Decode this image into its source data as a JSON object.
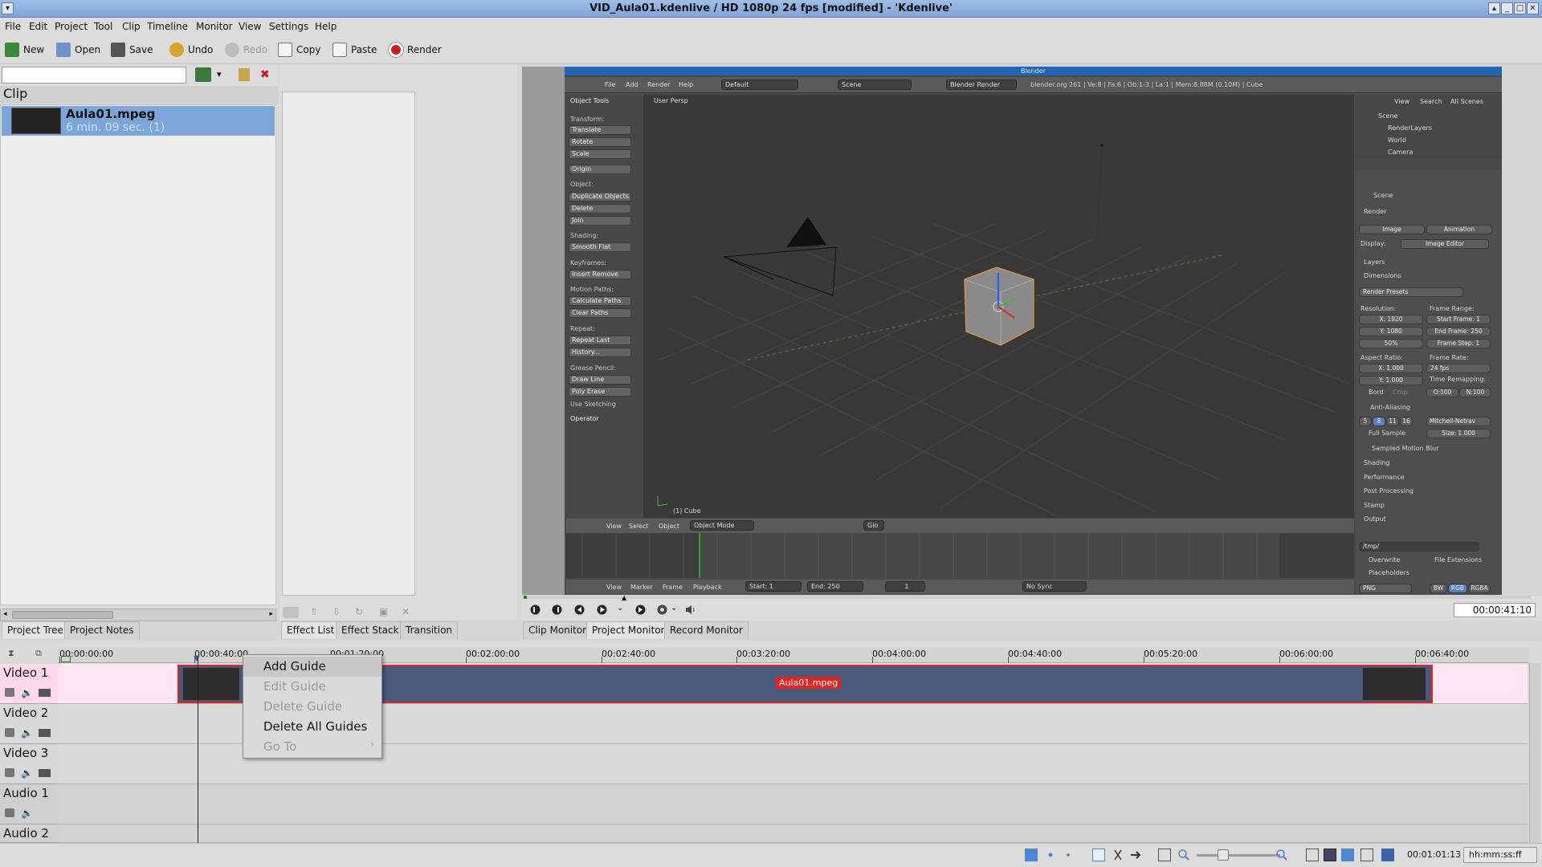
{
  "window": {
    "title": "VID_Aula01.kdenlive / HD 1080p 24 fps [modified] - 'Kdenlive'",
    "buttons": [
      "▴",
      "_",
      "□",
      "✕"
    ]
  },
  "menu": [
    "File",
    "Edit",
    "Project",
    "Tool",
    "Clip",
    "Timeline",
    "Monitor",
    "View",
    "Settings",
    "Help"
  ],
  "toolbar": {
    "new": "New",
    "open": "Open",
    "save": "Save",
    "undo": "Undo",
    "redo": "Redo",
    "copy": "Copy",
    "paste": "Paste",
    "render": "Render"
  },
  "project_tree": {
    "search_value": "",
    "header": "Clip",
    "clips": [
      {
        "name": "Aula01.mpeg",
        "duration": "6 min. 09 sec. (1)"
      }
    ]
  },
  "left_tabs": [
    "Project Tree",
    "Project Notes"
  ],
  "effect_tabs": [
    "Effect List",
    "Effect Stack",
    "Transition"
  ],
  "monitor_tabs": [
    "Clip Monitor",
    "Project Monitor",
    "Record Monitor"
  ],
  "monitor": {
    "timecode": "00:00:41:10"
  },
  "blender": {
    "title": "Blender",
    "menu": [
      "File",
      "Add",
      "Render",
      "Help"
    ],
    "layout": "Default",
    "scene": "Scene",
    "engine": "Blender Render",
    "info": "blender.org 261 | Ve:8 | Fa:6 | Ob:1-3 | La:1 | Mem:6.88M (0.10M) | Cube",
    "view_label": "User Persp",
    "object_label": "(1) Cube",
    "tools": {
      "header": "Object Tools",
      "transform_label": "Transform:",
      "transform": [
        "Translate",
        "Rotate",
        "Scale"
      ],
      "origin": "Origin",
      "object_label": "Object:",
      "object": [
        "Duplicate Objects",
        "Delete",
        "Join"
      ],
      "shading_label": "Shading:",
      "shading": "Smooth   Flat",
      "keyframes_label": "Keyframes:",
      "keyframes": "Insert      Remove",
      "motion_label": "Motion Paths:",
      "motion": [
        "Calculate Paths",
        "Clear Paths"
      ],
      "repeat_label": "Repeat:",
      "repeat": [
        "Repeat Last",
        "History..."
      ],
      "grease_label": "Grease Pencil:",
      "grease": [
        "Draw       Line",
        "Poly       Erase"
      ],
      "sketching": "Use Sketching",
      "operator": "Operator"
    },
    "viewport_menu": [
      "View",
      "Select",
      "Object"
    ],
    "mode": "Object Mode",
    "pivot": "Glo",
    "timeline_menu": [
      "View",
      "Marker",
      "Frame",
      "Playback"
    ],
    "start": "Start: 1",
    "end": "End: 250",
    "frame": "1",
    "sync": "No Sync",
    "outliner": {
      "menu": [
        "View",
        "Search",
        "All Scenes"
      ],
      "items": [
        "Scene",
        "RenderLayers",
        "World",
        "Camera"
      ]
    },
    "props": {
      "scene": "Scene",
      "render": "Render",
      "image": "Image",
      "animation": "Animation",
      "display_label": "Display:",
      "display": "Image Editor",
      "layers": "Layers",
      "dimensions": "Dimensions",
      "presets": "Render Presets",
      "resolution": "Resolution:",
      "frame_range": "Frame Range:",
      "res_x": "X: 1920",
      "res_y": "Y: 1080",
      "res_pct": "50%",
      "start_frame": "Start Frame: 1",
      "end_frame": "End Frame: 250",
      "frame_step": "Frame Step: 1",
      "aspect": "Aspect Ratio:",
      "frame_rate": "Frame Rate:",
      "asp_x": "X: 1.000",
      "asp_y": "Y: 1.000",
      "fps": "24 fps",
      "remap": "Time Remapping:",
      "border": "Bord",
      "crop": "Crop",
      "old": "O:100",
      "new": "N:100",
      "aa": "Anti-Aliasing",
      "aa_levels": [
        "5",
        "8",
        "11",
        "16"
      ],
      "filter": "Mitchell-Netrav",
      "full_sample": "Full Sample",
      "size": "Size: 1.000",
      "smb": "Sampled Motion Blur",
      "shading": "Shading",
      "performance": "Performance",
      "post": "Post Processing",
      "stamp": "Stamp",
      "output": "Output",
      "path": "/tmp/",
      "overwrite": "Overwrite",
      "file_ext": "File Extensions",
      "placeholders": "Placeholders",
      "format": "PNG",
      "bw": "BW",
      "rgb": "RGB",
      "rgba": "RGBA"
    }
  },
  "timeline": {
    "ruler": [
      "00:00:00:00",
      "00:00:40:00",
      "00:01:20:00",
      "00:02:00:00",
      "00:02:40:00",
      "00:03:20:00",
      "00:04:00:00",
      "00:04:40:00",
      "00:05:20:00",
      "00:06:00:00",
      "00:06:40:00"
    ],
    "tracks": [
      "Video 1",
      "Video 2",
      "Video 3",
      "Audio 1",
      "Audio 2"
    ],
    "clip_label": "Aula01.mpeg"
  },
  "context_menu": [
    "Add Guide",
    "Edit Guide",
    "Delete Guide",
    "Delete All Guides",
    "Go To"
  ],
  "status": {
    "time": "00:01:01:13",
    "format": "hh:mm:ss:ff"
  },
  "colors": {
    "selection": "#7ca5d9",
    "clip_border": "#e0231f",
    "track_video1": "#ffe6f2",
    "titlebar": "#8fb1df",
    "blender_bg": "#393939"
  }
}
